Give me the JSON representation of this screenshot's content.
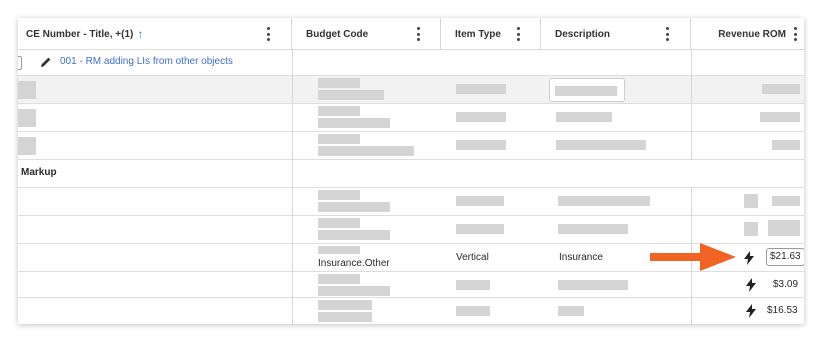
{
  "columns": {
    "ce_number": {
      "label": "CE Number - Title, +(1)"
    },
    "budget_code": {
      "label": "Budget Code"
    },
    "item_type": {
      "label": "Item Type"
    },
    "description": {
      "label": "Description"
    },
    "revenue_rom": {
      "label": "Revenue ROM"
    }
  },
  "group": {
    "title": "001 - RM adding LIs from other objects"
  },
  "section": {
    "title": "Markup"
  },
  "markup_row": {
    "budget_code": "Insurance.Other",
    "item_type": "Vertical",
    "description": "Insurance",
    "revenue_rom": "$21.63"
  },
  "rom_values": [
    "$3.09",
    "$16.53"
  ],
  "icons": {
    "sort": "arrow-up-icon",
    "edit": "pencil-icon",
    "bolt": "lightning-bolt-icon",
    "menu": "kebab-menu-icon",
    "callout": "orange-arrow-icon"
  },
  "colors": {
    "link": "#3b6fd1",
    "callout_arrow": "#f06322",
    "placeholder": "#d4d4d4"
  }
}
